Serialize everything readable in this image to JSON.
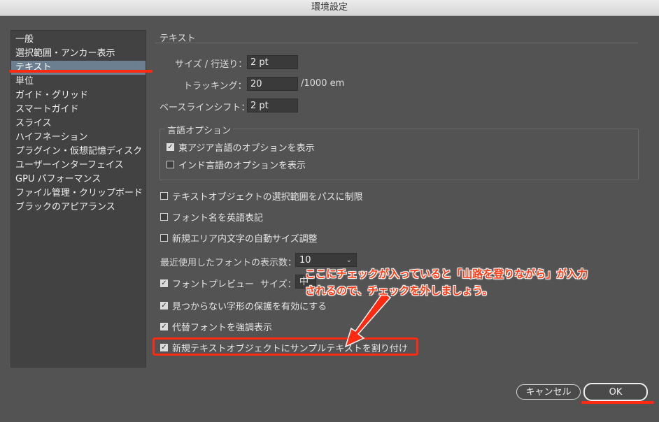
{
  "window": {
    "title": "環境設定"
  },
  "sidebar": {
    "items": [
      {
        "label": "一般"
      },
      {
        "label": "選択範囲・アンカー表示"
      },
      {
        "label": "テキスト",
        "selected": true
      },
      {
        "label": "単位"
      },
      {
        "label": "ガイド・グリッド"
      },
      {
        "label": "スマートガイド"
      },
      {
        "label": "スライス"
      },
      {
        "label": "ハイフネーション"
      },
      {
        "label": "プラグイン・仮想記憶ディスク"
      },
      {
        "label": "ユーザーインターフェイス"
      },
      {
        "label": "GPU パフォーマンス"
      },
      {
        "label": "ファイル管理・クリップボード"
      },
      {
        "label": "ブラックのアピアランス"
      }
    ]
  },
  "text_prefs": {
    "section_title": "テキスト",
    "size_leading": {
      "label": "サイズ / 行送り：",
      "value": "2 pt"
    },
    "tracking": {
      "label": "トラッキング：",
      "value": "20",
      "unit": "/1000 em"
    },
    "baseline_shift": {
      "label": "ベースラインシフト：",
      "value": "2 pt"
    },
    "language_options": {
      "title": "言語オプション",
      "east_asian": {
        "label": "東アジア言語のオプションを表示",
        "checked": true
      },
      "indic": {
        "label": "インド言語のオプションを表示",
        "checked": false
      }
    },
    "limit_selection_to_path": {
      "label": "テキストオブジェクトの選択範囲をパスに制限",
      "checked": false
    },
    "font_names_english": {
      "label": "フォント名を英語表記",
      "checked": false
    },
    "auto_size_area": {
      "label": "新規エリア内文字の自動サイズ調整",
      "checked": false
    },
    "recent_fonts": {
      "label": "最近使用したフォントの表示数：",
      "value": "10"
    },
    "font_preview": {
      "label": "フォントプレビュー",
      "checked": true,
      "size_label": "サイズ：",
      "size_value": "中"
    },
    "protect_missing_glyph": {
      "label": "見つからない字形の保護を有効にする",
      "checked": true
    },
    "highlight_substituted": {
      "label": "代替フォントを強調表示",
      "checked": true
    },
    "fill_placeholder": {
      "label": "新規テキストオブジェクトにサンプルテキストを割り付け",
      "checked": true
    }
  },
  "annotation": {
    "line1": "ここにチェックが入っていると「山路を登りながら」が入力",
    "line2": "されるので、チェックを外しましょう。",
    "color": "#ff2a12"
  },
  "buttons": {
    "cancel": "キャンセル",
    "ok": "OK"
  }
}
